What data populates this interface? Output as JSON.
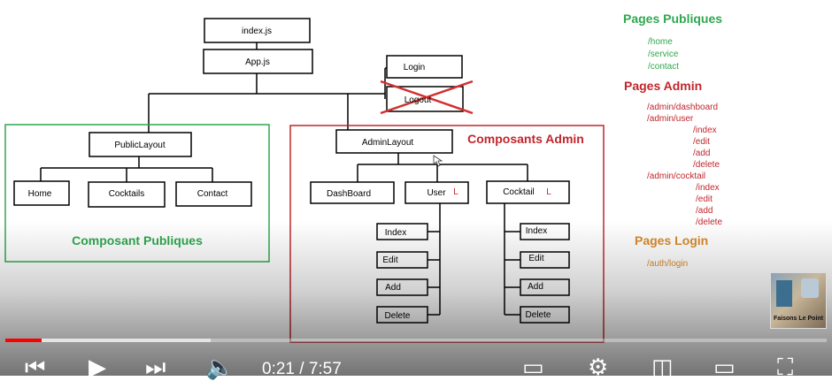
{
  "diagram": {
    "nodes": {
      "index_js": "index.js",
      "app_js": "App.js",
      "login": "Login",
      "logout": "Logout",
      "public_layout": "PublicLayout",
      "home": "Home",
      "cocktails": "Cocktails",
      "contact": "Contact",
      "admin_layout": "AdminLayout",
      "dashboard": "DashBoard",
      "user": "User",
      "cocktail": "Cocktail",
      "user_marker": "L",
      "cocktail_marker": "L",
      "user_children": [
        "Index",
        "Edit",
        "Add",
        "Delete"
      ],
      "cocktail_children": [
        "Index",
        "Edit",
        "Add",
        "Delete"
      ]
    },
    "groups": {
      "public_title": "Composant Publiques",
      "admin_title": "Composants Admin"
    },
    "colors": {
      "public_green": "#2fa84f",
      "admin_red": "#c0262c",
      "login_orange": "#d98a2b",
      "cross_red": "#d23030"
    }
  },
  "routes": {
    "public": {
      "title": "Pages Publiques",
      "items": [
        "/home",
        "/service",
        "/contact"
      ]
    },
    "admin": {
      "title": "Pages Admin",
      "items": [
        {
          "text": "/admin/dashboard",
          "level": 0
        },
        {
          "text": "/admin/user",
          "level": 0
        },
        {
          "text": "/index",
          "level": 1
        },
        {
          "text": "/edit",
          "level": 1
        },
        {
          "text": "/add",
          "level": 1
        },
        {
          "text": "/delete",
          "level": 1
        },
        {
          "text": "/admin/cocktail",
          "level": 0
        },
        {
          "text": "/index",
          "level": 1
        },
        {
          "text": "/edit",
          "level": 1
        },
        {
          "text": "/add",
          "level": 1
        },
        {
          "text": "/delete",
          "level": 1
        }
      ]
    },
    "login": {
      "title": "Pages Login",
      "items": [
        "/auth/login"
      ]
    }
  },
  "player": {
    "time": "0:21 / 7:57",
    "progress_fraction": 0.044,
    "buffer_fraction": 0.25,
    "channel_text": "Faisons Le Point"
  }
}
